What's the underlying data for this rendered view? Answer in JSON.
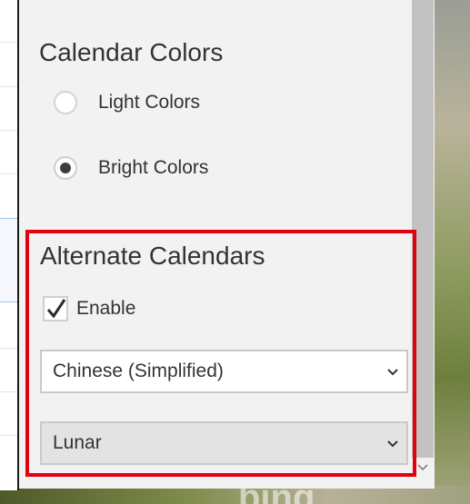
{
  "settings": {
    "calendar_colors": {
      "title": "Calendar Colors",
      "options": [
        {
          "label": "Light Colors",
          "selected": false
        },
        {
          "label": "Bright Colors",
          "selected": true
        }
      ]
    },
    "alternate_calendars": {
      "title": "Alternate Calendars",
      "enable_label": "Enable",
      "enabled": true,
      "language_select": {
        "value": "Chinese (Simplified)"
      },
      "type_select": {
        "value": "Lunar"
      }
    }
  },
  "background": {
    "brand_text": "bing"
  },
  "colors": {
    "highlight": "#e3000f",
    "panel_background": "#f2f2f2",
    "scrollbar_thumb": "#c2c2c2"
  },
  "icons": {
    "checkmark": "checkmark-icon",
    "dropdown": "chevron-down-icon",
    "scroll_down": "scroll-down-arrow-icon"
  }
}
